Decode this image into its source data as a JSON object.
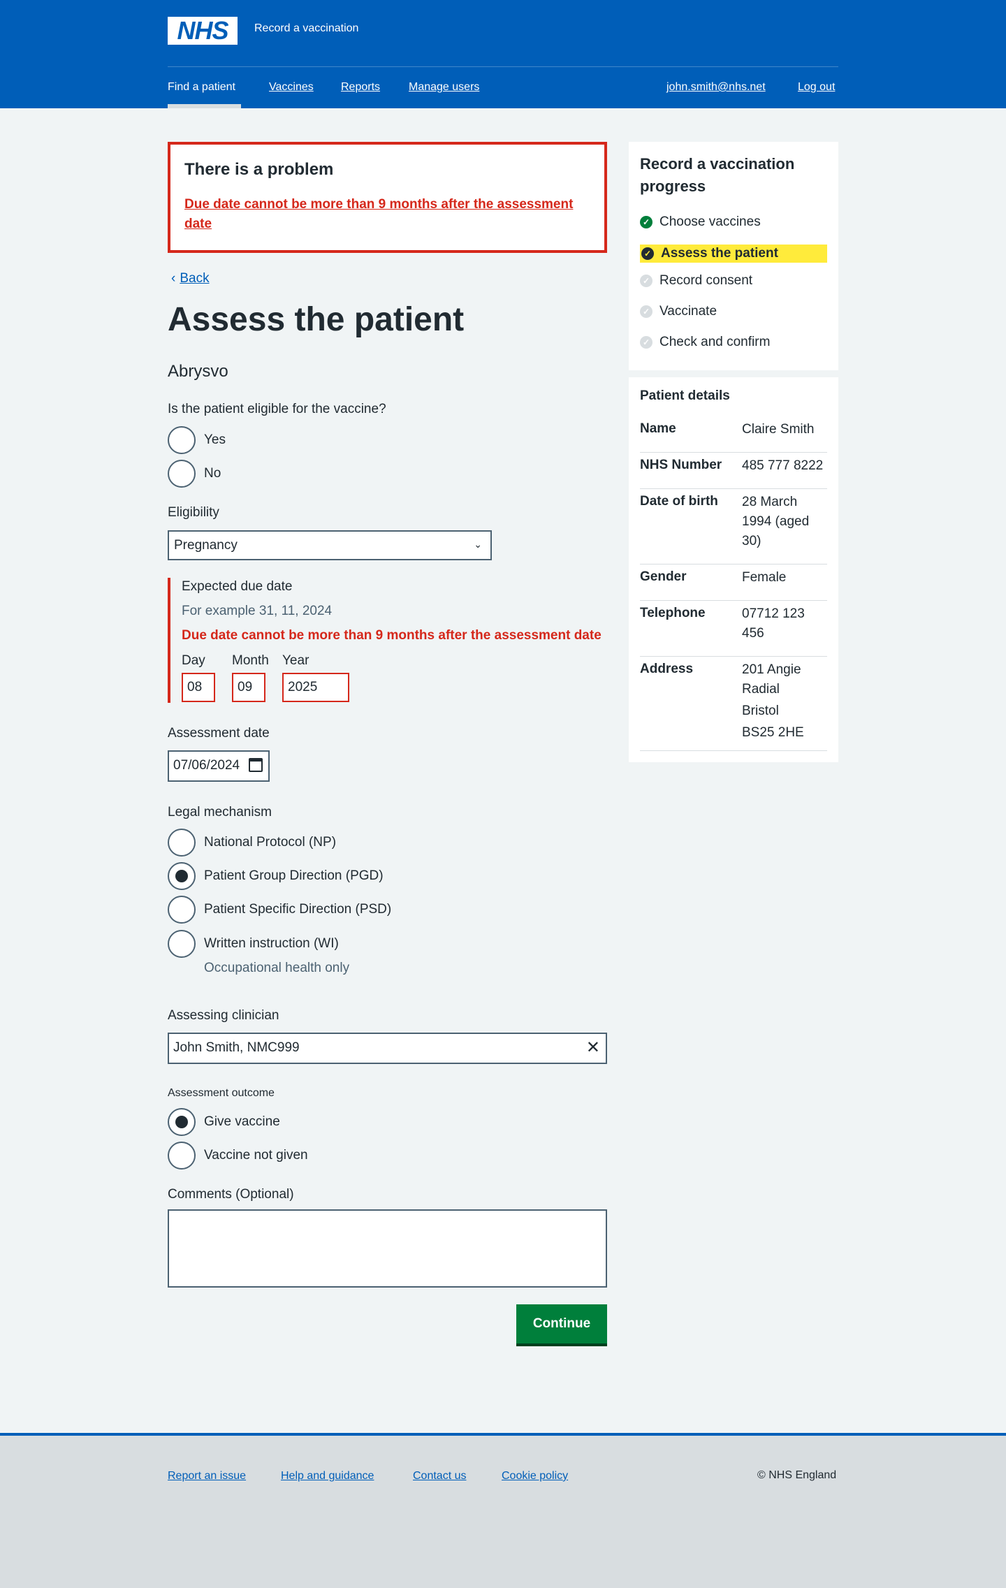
{
  "header": {
    "logo": "NHS",
    "service_name": "Record a vaccination",
    "nav": {
      "find_patient": "Find a patient",
      "vaccines": "Vaccines",
      "reports": "Reports",
      "manage_users": "Manage users",
      "user_email": "john.smith@nhs.net",
      "log_out": "Log out"
    }
  },
  "error_summary": {
    "title": "There is a problem",
    "message": "Due date cannot be more than 9 months after the assessment date"
  },
  "back_link": "Back",
  "page_title": "Assess the patient",
  "vaccine_name": "Abrysvo",
  "eligible": {
    "question": "Is the patient eligible for the vaccine?",
    "options": [
      "Yes",
      "No"
    ]
  },
  "eligibility": {
    "label": "Eligibility",
    "selected": "Pregnancy"
  },
  "due_date": {
    "legend": "Expected due date",
    "hint": "For example 31, 11, 2024",
    "error": "Due date cannot be more than 9 months after the assessment date",
    "day_label": "Day",
    "month_label": "Month",
    "year_label": "Year",
    "day": "08",
    "month": "09",
    "year": "2025"
  },
  "assessment_date": {
    "label": "Assessment date",
    "value": "07/06/2024"
  },
  "legal_mechanism": {
    "label": "Legal mechanism",
    "options": [
      "National Protocol (NP)",
      "Patient Group Direction (PGD)",
      "Patient Specific Direction (PSD)",
      "Written instruction (WI)"
    ],
    "selected_index": 1,
    "wi_hint": "Occupational health only"
  },
  "clinician": {
    "label": "Assessing clinician",
    "value": "John Smith, NMC999"
  },
  "outcome": {
    "label": "Assessment outcome",
    "options": [
      "Give vaccine",
      "Vaccine not given"
    ],
    "selected_index": 0
  },
  "comments": {
    "label": "Comments (Optional)",
    "value": ""
  },
  "continue_label": "Continue",
  "progress": {
    "title": "Record a vaccination progress",
    "steps": [
      {
        "label": "Choose vaccines",
        "state": "done"
      },
      {
        "label": "Assess the patient",
        "state": "current"
      },
      {
        "label": "Record consent",
        "state": "todo"
      },
      {
        "label": "Vaccinate",
        "state": "todo"
      },
      {
        "label": "Check and confirm",
        "state": "todo"
      }
    ]
  },
  "patient": {
    "title": "Patient details",
    "name_label": "Name",
    "name": "Claire Smith",
    "nhs_label": "NHS Number",
    "nhs": "485 777 8222",
    "dob_label": "Date of birth",
    "dob": "28 March 1994 (aged 30)",
    "gender_label": "Gender",
    "gender": "Female",
    "phone_label": "Telephone",
    "phone": "07712 123 456",
    "address_label": "Address",
    "address_line1": "201 Angie Radial",
    "address_line2": "Bristol",
    "address_line3": "BS25 2HE"
  },
  "footer": {
    "report_issue": "Report an issue",
    "help": "Help and guidance",
    "contact": "Contact us",
    "cookie": "Cookie policy",
    "copyright": "© NHS England"
  },
  "colors": {
    "brand_blue": "#005eb8",
    "error_red": "#d5281b",
    "success_green": "#007f3b",
    "highlight_yellow": "#ffeb3b"
  }
}
